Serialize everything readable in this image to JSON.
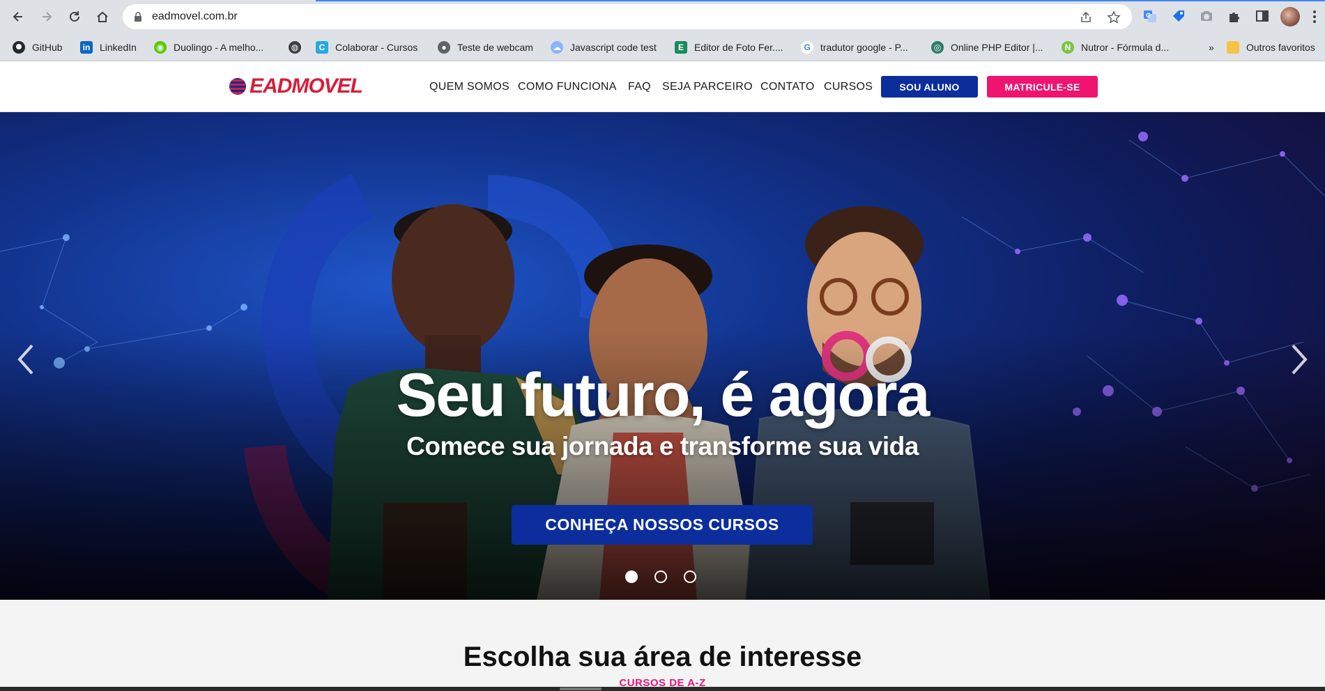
{
  "browser": {
    "url": "eadmovel.com.br",
    "bookmarks": [
      {
        "label": "GitHub",
        "icon": "github-icon",
        "color": "#24292e"
      },
      {
        "label": "LinkedIn",
        "icon": "linkedin-icon",
        "color": "#0a66c2"
      },
      {
        "label": "Duolingo - A melho...",
        "icon": "duolingo-icon",
        "color": "#58cc02"
      },
      {
        "label": "",
        "icon": "globe-icon",
        "color": "#3c4043"
      },
      {
        "label": "Colaborar - Cursos",
        "icon": "colaborar-icon",
        "color": "#29a8e0"
      },
      {
        "label": "Teste de webcam",
        "icon": "webcam-icon",
        "color": "#5f6368"
      },
      {
        "label": "Javascript code test",
        "icon": "cloud-icon",
        "color": "#8ab4f8"
      },
      {
        "label": "Editor de Foto Fer....",
        "icon": "photo-editor-icon",
        "color": "#1a8a5a"
      },
      {
        "label": "tradutor google - P...",
        "icon": "google-icon",
        "color": "#4285f4"
      },
      {
        "label": "Online PHP Editor |...",
        "icon": "php-editor-icon",
        "color": "#2e7d6b"
      },
      {
        "label": "Nutror - Fórmula d...",
        "icon": "nutror-icon",
        "color": "#7cc242"
      }
    ],
    "bookmarks_overflow": "»",
    "other_bookmarks": "Outros favoritos"
  },
  "site": {
    "logo_text": "EADMOVEL",
    "nav": [
      "QUEM SOMOS",
      "COMO FUNCIONA",
      "FAQ",
      "SEJA PARCEIRO",
      "CONTATO",
      "CURSOS"
    ],
    "btn_aluno": "SOU ALUNO",
    "btn_matricule": "MATRICULE-SE",
    "colors": {
      "brand_blue": "#0c2d9c",
      "brand_pink": "#ef1470",
      "brand_red": "#d71e3a"
    }
  },
  "hero": {
    "title": "Seu futuro, é agora",
    "subtitle": "Comece sua jornada e transforme sua vida",
    "cta": "CONHEÇA NOSSOS CURSOS",
    "slides": 3,
    "active_slide": 1
  },
  "section": {
    "title": "Escolha sua área de interesse",
    "subtitle": "CURSOS DE A-Z"
  }
}
